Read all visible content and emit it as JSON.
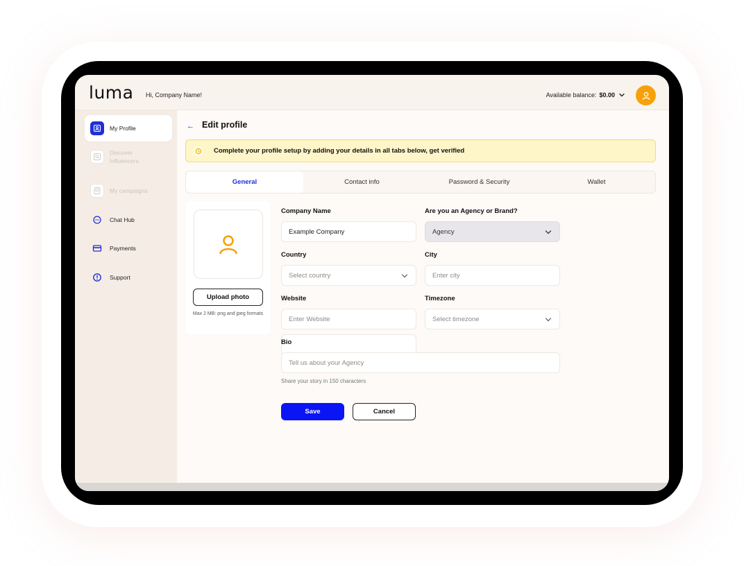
{
  "app": {
    "logo": "luma",
    "greeting": "Hi, Company Name!",
    "balance_label": "Available balance:",
    "balance_value": "$0.00"
  },
  "sidebar": {
    "items": [
      {
        "label": "My Profile",
        "icon": "profile-icon",
        "state": "active"
      },
      {
        "label": "Discover Influencers",
        "icon": "discover-icon",
        "state": "disabled"
      },
      {
        "label": "My campaigns",
        "icon": "campaigns-icon",
        "state": "disabled"
      },
      {
        "label": "Chat Hub",
        "icon": "chat-icon",
        "state": "normal"
      },
      {
        "label": "Payments",
        "icon": "card-icon",
        "state": "normal"
      },
      {
        "label": "Support",
        "icon": "info-icon",
        "state": "normal"
      }
    ]
  },
  "page": {
    "back_icon": "←",
    "title": "Edit profile",
    "alert": "Complete your profile setup by  adding your details in all tabs below, get verified"
  },
  "tabs": [
    "General",
    "Contact info",
    "Password & Security",
    "Wallet"
  ],
  "active_tab": "General",
  "photo": {
    "upload_label": "Upload photo",
    "hint": "Max 2 MB: png and jpeg formats"
  },
  "form": {
    "company_name": {
      "label": "Company Name",
      "value": "Example Company"
    },
    "agency_brand": {
      "label": "Are you an Agency or Brand?",
      "value": "Agency"
    },
    "country": {
      "label": "Country",
      "placeholder": "Select country"
    },
    "city": {
      "label": "City",
      "placeholder": "Enter city"
    },
    "website": {
      "label": "Website",
      "placeholder": "Enter Website"
    },
    "timezone": {
      "label": "Timezone",
      "placeholder": "Select timezone"
    },
    "bio": {
      "label": "Bio",
      "placeholder": "Tell us about your Agency",
      "hint": "Share your story in 150 characters"
    }
  },
  "actions": {
    "save": "Save",
    "cancel": "Cancel"
  },
  "colors": {
    "primary": "#0a15f5",
    "accent": "#f7a10a",
    "alert_bg": "#fef5c9"
  }
}
